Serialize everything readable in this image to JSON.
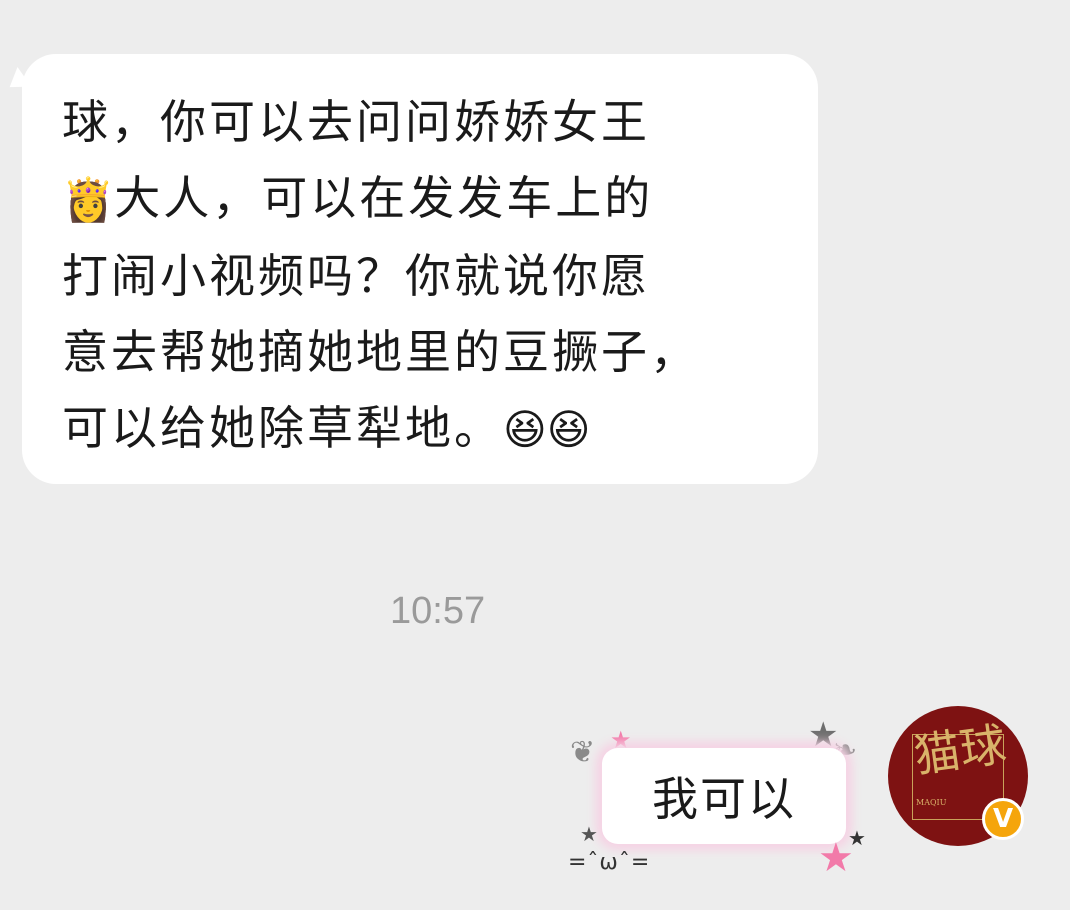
{
  "incoming_message": {
    "lines": [
      "球，你可以去问问娇娇女王",
      "大人，可以在发发车上的",
      "打闹小视频吗？你就说你愿",
      "意去帮她摘她地里的豆撅子，",
      "可以给她除草犁地。"
    ],
    "emoji_crown": "👸",
    "emoji_laugh": "😆😆"
  },
  "timestamp": "10:57",
  "outgoing_message": {
    "text": "我可以",
    "decoration_face": "=ˆωˆ="
  },
  "avatar": {
    "text": "猫球",
    "small_text": "MAQIU",
    "badge": "V"
  },
  "colors": {
    "background": "#ededed",
    "bubble": "#ffffff",
    "accent_pink": "#f27aa9",
    "avatar_bg": "#7e1212",
    "badge": "#f5a50c"
  }
}
